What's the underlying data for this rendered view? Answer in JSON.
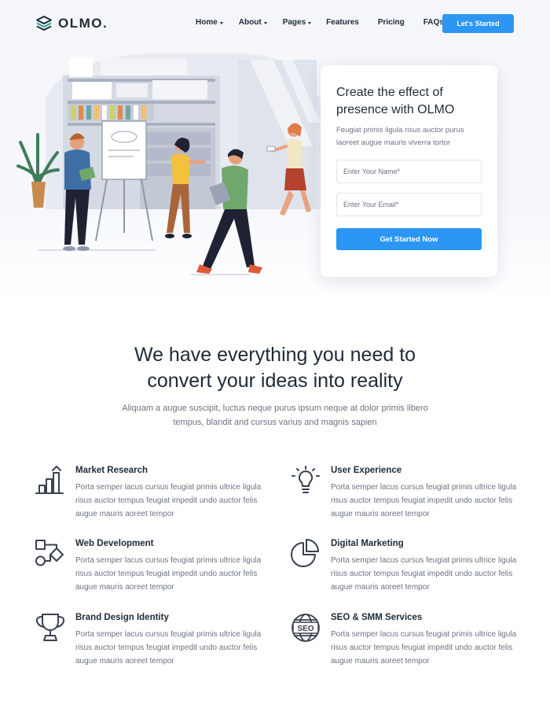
{
  "header": {
    "logo_text": "OLMO.",
    "nav": [
      {
        "label": "Home",
        "dropdown": true
      },
      {
        "label": "About",
        "dropdown": true
      },
      {
        "label": "Pages",
        "dropdown": true
      },
      {
        "label": "Features",
        "dropdown": false
      },
      {
        "label": "Pricing",
        "dropdown": false
      },
      {
        "label": "FAQs",
        "dropdown": false
      }
    ],
    "cta_label": "Let's Started"
  },
  "hero_form": {
    "title": "Create the effect of presence with OLMO",
    "description": "Feugiat primis ligula risus auctor purus laoreet augue mauris viverra tortor",
    "name_placeholder": "Enter Your Name*",
    "email_placeholder": "Enter Your Email*",
    "submit_label": "Get Started Now"
  },
  "features_section": {
    "title": "We have everything you need to convert your ideas into reality",
    "subtitle": "Aliquam a augue suscipit, luctus neque purus ipsum neque at dolor primis libero tempus, blandit and cursus varius and magnis sapien",
    "items": [
      {
        "title": "Market Research",
        "icon": "bar-chart-icon",
        "text": "Porta semper lacus cursus feugiat primis ultrice ligula risus auctor tempus feugiat impedit undo auctor felis augue mauris aoreet tempor"
      },
      {
        "title": "User Experience",
        "icon": "lightbulb-icon",
        "text": "Porta semper lacus cursus feugiat primis ultrice ligula risus auctor tempus feugiat impedit undo auctor felis augue mauris aoreet tempor"
      },
      {
        "title": "Web Development",
        "icon": "flowchart-icon",
        "text": "Porta semper lacus cursus feugiat primis ultrice ligula risus auctor tempus feugiat impedit undo auctor felis augue mauris aoreet tempor"
      },
      {
        "title": "Digital Marketing",
        "icon": "pie-chart-icon",
        "text": "Porta semper lacus cursus feugiat primis ultrice ligula risus auctor tempus feugiat impedit undo auctor felis augue mauris aoreet tempor"
      },
      {
        "title": "Brand Design Identity",
        "icon": "trophy-icon",
        "text": "Porta semper lacus cursus feugiat primis ultrice ligula risus auctor tempus feugiat impedit undo auctor felis augue mauris aoreet tempor"
      },
      {
        "title": "SEO & SMM Services",
        "icon": "seo-globe-icon",
        "text": "Porta semper lacus cursus feugiat primis ultrice ligula risus auctor tempus feugiat impedit undo auctor felis augue mauris aoreet tempor"
      }
    ]
  },
  "colors": {
    "accent": "#2b96f3",
    "heading": "#1f2a37",
    "body": "#6b7280",
    "logo_mark": "#2a9d8f"
  }
}
